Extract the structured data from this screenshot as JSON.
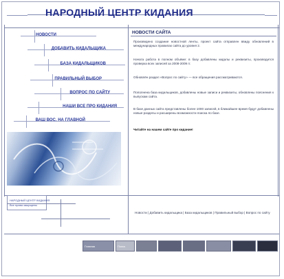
{
  "title": "НАРОДНЫЙ ЦЕНТР КИДАНИЯ",
  "nav": {
    "items": [
      {
        "label": "НОВОСТИ"
      },
      {
        "label": "ДОБАВИТЬ КИДАЛЬЩИКА"
      },
      {
        "label": "БАЗА КИДАЛЬЩИКОВ"
      },
      {
        "label": "ПРАВИЛЬНЫЙ ВЫБОР"
      },
      {
        "label": "ВОПРОС ПО САЙТУ"
      },
      {
        "label": "НАШИ ВСЕ ПРО КИДАНИЯ"
      },
      {
        "label": "ВАШ ВОС. НА ГЛАВНОЙ"
      }
    ]
  },
  "news": {
    "heading": "НОВОСТИ САЙТА",
    "items": [
      "Произведено создание новостной ленты, проект сайта отправлен ввиду обновлений в международных правилах сайта до уровня 2.",
      "Начата работа в полном объёме: в базу добавлены кидалы и реквизиты, производится проверка всех записей за 2008-2009 гг.",
      "Обновлён раздел «Вопрос по сайту» — все обращения рассматриваются.",
      "Пополнена база кидальщиков, добавлены новые записи и реквизиты, обновлены пояснения к выпускам сайта.",
      "В базе данных сайта представлены более 1000 записей, в ближайшее время будут добавлены новые разделы и расширены возможности поиска по базе.",
      "Читайте на нашем сайте про кидание!"
    ]
  },
  "bottom_block": {
    "line1": "НАРОДНЫЙ ЦЕНТР КИДАНИЯ",
    "line2": "Все права защищены"
  },
  "footer": {
    "links": "Новости | Добавить кидальщика | База кидальщиков | Правильный выбор | Вопрос по сайту"
  },
  "toolbar": {
    "labels": [
      "Главная",
      "Поиск",
      "",
      "",
      "",
      "",
      ""
    ]
  },
  "colors": {
    "brand": "#1e2a88",
    "lines": "#7a82a8",
    "nav_text": "#2b3a9a"
  }
}
